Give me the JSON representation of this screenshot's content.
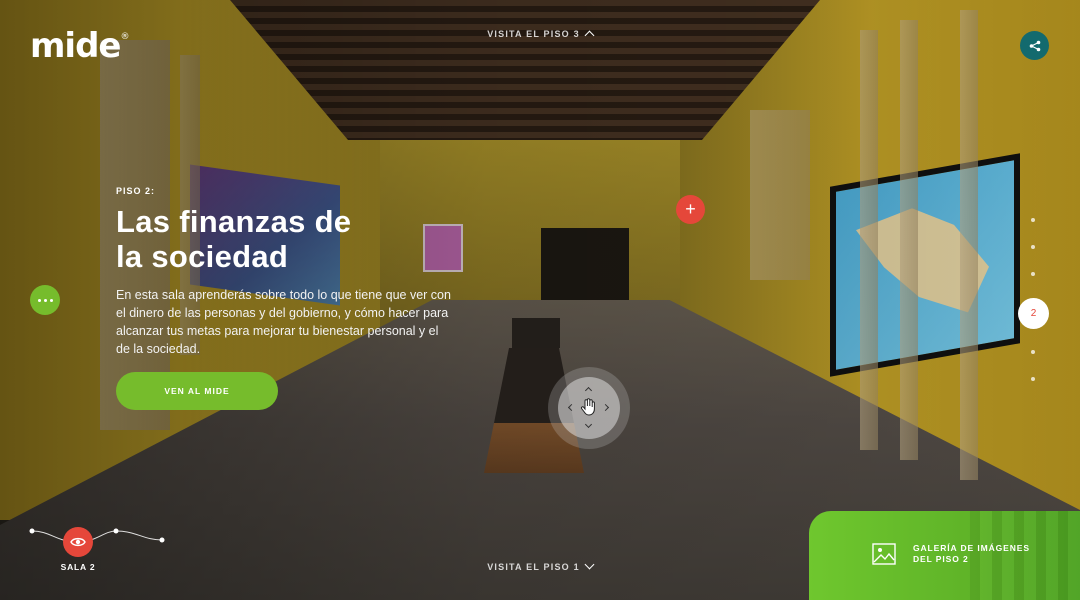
{
  "brand": {
    "logo_text": "mide",
    "logo_mark": "®"
  },
  "navigation": {
    "up_label": "VISITA EL PISO 3",
    "down_label": "VISITA EL PISO 1"
  },
  "room": {
    "kicker": "PISO 2:",
    "title": "Las finanzas de la sociedad",
    "description": "En esta sala aprenderás sobre todo lo que tiene que ver con el dinero de las personas y del gobierno, y cómo hacer para alcanzar tus metas para mejorar tu bienestar personal y el de la sociedad.",
    "cta_label": "VEN AL MIDE"
  },
  "hotspot": {
    "symbol": "+"
  },
  "pagination": {
    "active_label": "2",
    "total_dots": 7,
    "active_index": 3
  },
  "timeline": {
    "current_room_label": "SALA 2"
  },
  "gallery": {
    "label": "GALERÍA DE IMÁGENES DEL PISO  2"
  },
  "colors": {
    "accent_green": "#76bc2c",
    "accent_red": "#e5473a",
    "share_teal": "#136a6e"
  },
  "icons": [
    "share-icon",
    "more-dots-icon",
    "plus-icon",
    "hand-drag-icon",
    "eye-icon",
    "image-gallery-icon",
    "chevron-up-icon",
    "chevron-down-icon"
  ]
}
